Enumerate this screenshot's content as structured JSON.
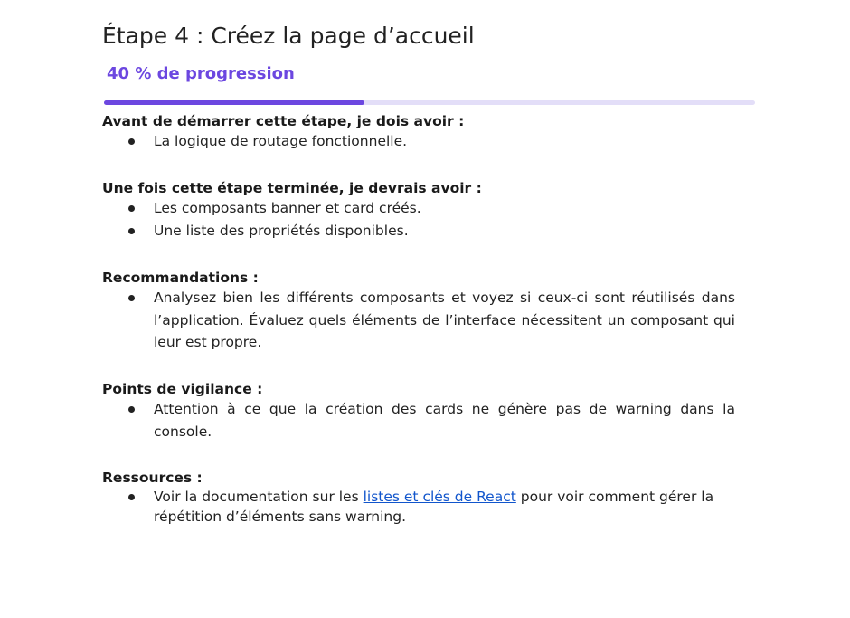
{
  "title": "Étape 4 : Créez la page d’accueil",
  "progress": {
    "label": "40 % de progression",
    "value": 0.4,
    "label_color": "#6c47e0",
    "fill_color": "#6c47e0",
    "track_color": "#e3def8"
  },
  "sections": {
    "prerequisites": {
      "heading": "Avant de démarrer cette étape, je dois avoir :",
      "items": [
        "La logique de routage fonctionnelle."
      ]
    },
    "outcomes": {
      "heading": "Une fois cette étape terminée, je devrais avoir :",
      "items": [
        "Les composants banner et card créés.",
        "Une liste des propriétés disponibles."
      ]
    },
    "recommendations": {
      "heading": "Recommandations :",
      "items": [
        "Analysez bien les différents composants et voyez si ceux-ci sont réutilisés dans l’application. Évaluez quels éléments de l’interface nécessitent un composant qui leur est propre."
      ]
    },
    "watch_points": {
      "heading": "Points de vigilance :",
      "items": [
        "Attention à ce que la création des cards ne génère pas de warning dans la console."
      ]
    },
    "resources": {
      "heading": "Ressources :",
      "item": {
        "before": "Voir la documentation sur les ",
        "link": "listes et clés de React",
        "after": " pour voir comment gérer la répétition d’éléments sans warning."
      }
    }
  }
}
